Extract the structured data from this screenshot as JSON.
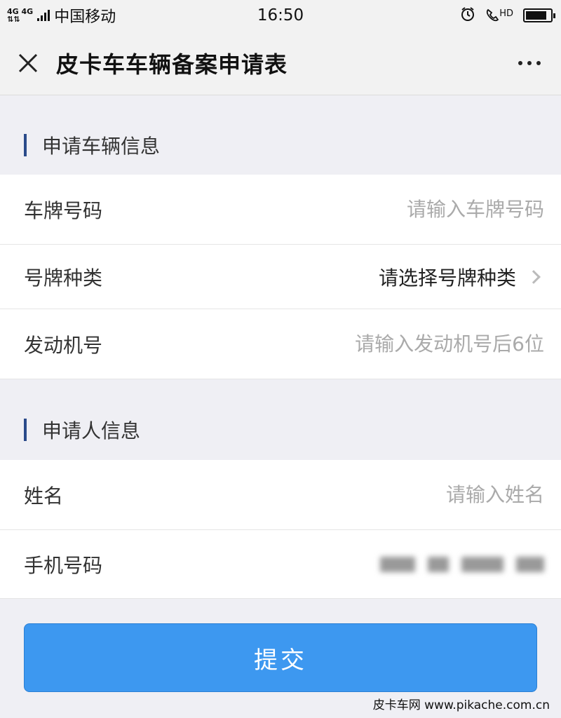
{
  "status_bar": {
    "network_top": "4G 4G",
    "carrier": "中国移动",
    "time": "16:50",
    "hd_label": "HD",
    "battery_level": 0.85
  },
  "nav": {
    "title": "皮卡车车辆备案申请表"
  },
  "sections": [
    {
      "title": "申请车辆信息",
      "fields": [
        {
          "label": "车牌号码",
          "type": "input",
          "placeholder": "请输入车牌号码",
          "value": ""
        },
        {
          "label": "号牌种类",
          "type": "select",
          "value": "请选择号牌种类"
        },
        {
          "label": "发动机号",
          "type": "input",
          "placeholder": "请输入发动机号后6位",
          "value": ""
        }
      ]
    },
    {
      "title": "申请人信息",
      "fields": [
        {
          "label": "姓名",
          "type": "input",
          "placeholder": "请输入姓名",
          "value": ""
        },
        {
          "label": "手机号码",
          "type": "input",
          "value": "(blurred)"
        }
      ]
    }
  ],
  "submit_label": "提交",
  "watermark": "皮卡车网 www.pikache.com.cn",
  "colors": {
    "accent_bar": "#2a4a8a",
    "submit_bg": "#3d98f0",
    "page_bg": "#efeff4"
  }
}
